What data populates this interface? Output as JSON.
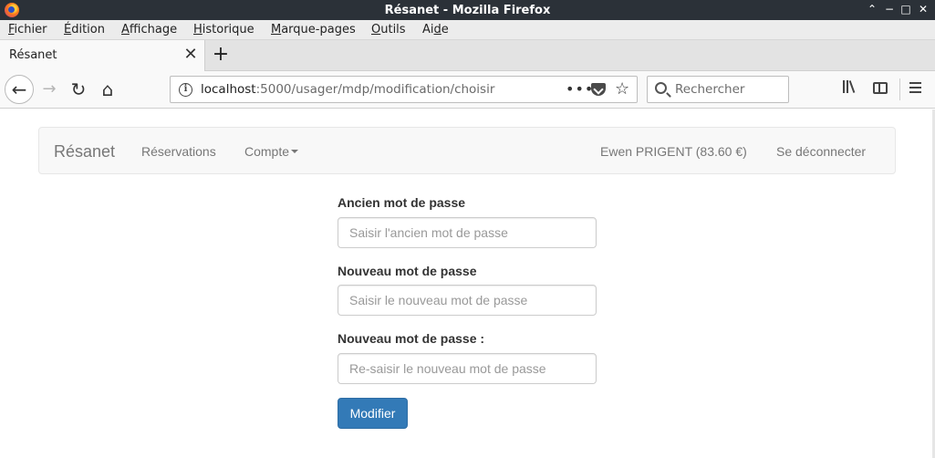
{
  "window": {
    "title": "Résanet - Mozilla Firefox",
    "controls": [
      "⌃",
      "−",
      "□",
      "✕"
    ]
  },
  "menubar": {
    "items": [
      {
        "label": "Fichier",
        "accesskey": "F"
      },
      {
        "label": "Édition",
        "accesskey": "É"
      },
      {
        "label": "Affichage",
        "accesskey": "A"
      },
      {
        "label": "Historique",
        "accesskey": "H"
      },
      {
        "label": "Marque-pages",
        "accesskey": "M"
      },
      {
        "label": "Outils",
        "accesskey": "O"
      },
      {
        "label": "Aide",
        "accesskey": "d"
      }
    ]
  },
  "tabs": {
    "active_label": "Résanet",
    "close_glyph": "✕",
    "new_tab_glyph": "+"
  },
  "navbar": {
    "back_glyph": "←",
    "forward_glyph": "→",
    "reload_glyph": "↻",
    "home_glyph": "⌂",
    "url_host": "localhost",
    "url_rest": ":5000/usager/mdp/modification/choisir",
    "page_actions_glyph": "•••",
    "bookmark_glyph": "☆",
    "search_placeholder": "Rechercher"
  },
  "site_nav": {
    "brand": "Résanet",
    "links": {
      "reservations": "Réservations",
      "compte": "Compte"
    },
    "user": "Ewen PRIGENT (83.60 €)",
    "logout": "Se déconnecter"
  },
  "form": {
    "old_password": {
      "label": "Ancien mot de passe",
      "placeholder": "Saisir l'ancien mot de passe",
      "value": ""
    },
    "new_password": {
      "label": "Nouveau mot de passe",
      "placeholder": "Saisir le nouveau mot de passe",
      "value": ""
    },
    "confirm_password": {
      "label": "Nouveau mot de passe :",
      "placeholder": "Re-saisir le nouveau mot de passe",
      "value": ""
    },
    "submit_label": "Modifier"
  },
  "colors": {
    "titlebar_bg": "#2b3138",
    "primary_button": "#337ab7",
    "navbar_bg": "#f8f8f8"
  }
}
